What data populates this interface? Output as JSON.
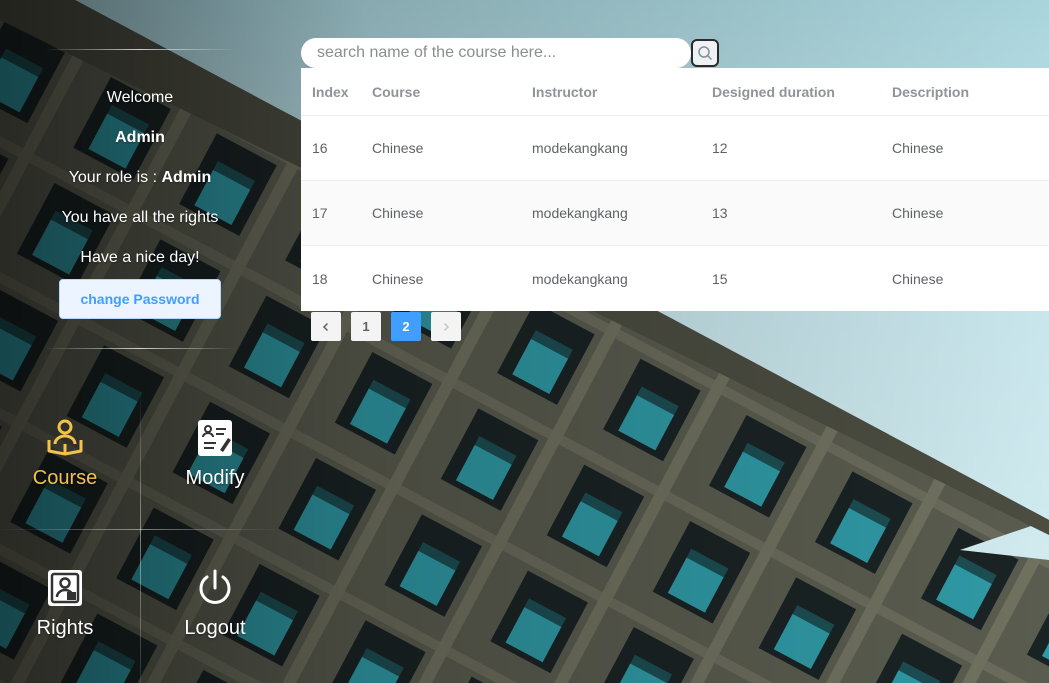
{
  "sidebar": {
    "welcome": "Welcome",
    "username": "Admin",
    "role_prefix": "Your role is : ",
    "role": "Admin",
    "rights_text": "You have all the rights",
    "greeting": "Have a nice day!",
    "change_password_label": "change Password"
  },
  "menu": {
    "course": {
      "label": "Course",
      "icon": "course-icon",
      "active": true
    },
    "modify": {
      "label": "Modify",
      "icon": "document-edit-icon"
    },
    "rights": {
      "label": "Rights",
      "icon": "user-badge-icon"
    },
    "logout": {
      "label": "Logout",
      "icon": "power-icon"
    }
  },
  "search": {
    "placeholder": "search name of the course here...",
    "value": ""
  },
  "table": {
    "headers": [
      "Index",
      "Course",
      "Instructor",
      "Designed duration",
      "Description"
    ],
    "rows": [
      [
        "16",
        "Chinese",
        "modekangkang",
        "12",
        "Chinese"
      ],
      [
        "17",
        "Chinese",
        "modekangkang",
        "13",
        "Chinese"
      ],
      [
        "18",
        "Chinese",
        "modekangkang",
        "15",
        "Chinese"
      ]
    ]
  },
  "pagination": {
    "pages": [
      "1",
      "2"
    ],
    "current": "2"
  },
  "colors": {
    "accent": "#409eff",
    "active_menu": "#f2c24a"
  }
}
